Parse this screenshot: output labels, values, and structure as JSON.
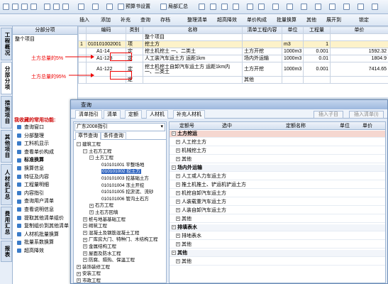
{
  "toolbar1": {
    "preview": "预算书设置",
    "local_summary": "局部汇总"
  },
  "toolbar2": {
    "insert": "插入",
    "add": "添加",
    "supplement": "补充",
    "query": "查询",
    "store": "存档",
    "organize": "整理清单",
    "super_drop": "超高降效",
    "unit_composition": "单价构成",
    "batch_replace": "批量换算",
    "other": "其他",
    "expand_to": "展开到",
    "lock": "锁定"
  },
  "vtabs": [
    "工程概况",
    "分部分项",
    "措施项目",
    "其他项目",
    "人材机汇总",
    "费用汇总",
    "报表"
  ],
  "left_panel": {
    "header": "分部分项",
    "root": "整个项目",
    "common_title": "我收藏的常用功能:",
    "common_items": [
      "查询窗口",
      "分部整理",
      "工料机显示",
      "查看单价构成",
      "标准换算",
      "换算信息",
      "特征及内容",
      "工程量明细",
      "内容指引",
      "查询用户清单",
      "查看说明信息",
      "提取其他清单组价",
      "复制组价到其他清单",
      "人材机批量换算",
      "批量系数换算",
      "超高降效"
    ]
  },
  "main_grid": {
    "headers": [
      "",
      "编码",
      "类别",
      "名称",
      "清单工程内容",
      "单位",
      "工程量",
      "单价"
    ],
    "rows": [
      {
        "num": "",
        "code": "",
        "type": "",
        "name": "整个项目",
        "content": "",
        "unit": "",
        "qty": "",
        "price": ""
      },
      {
        "num": "1",
        "code": "010101002001",
        "type": "项",
        "name": "挖土方",
        "content": "",
        "unit": "m3",
        "qty": "1",
        "price": ""
      },
      {
        "num": "",
        "code": "A1-14",
        "type": "定",
        "name": "挖土机挖土 一、二类土",
        "content": "土方开挖",
        "unit": "1000m3",
        "qty": "0.001",
        "price": "1592.32"
      },
      {
        "num": "",
        "code": "A1-128",
        "type": "定",
        "name": "人工装汽车运土方 运距1km",
        "content": "场内外运输",
        "unit": "1000m3",
        "qty": "0.01",
        "price": "1804.9"
      },
      {
        "num": "",
        "code": "A1-122",
        "type": "定",
        "name": "挖土机挖土自卸汽车运土方 运距1km内 一、二类土",
        "content": "土方开挖",
        "unit": "1000m3",
        "qty": "0.001",
        "price": "7414.65"
      },
      {
        "num": "",
        "code": "",
        "type": "定",
        "name": "",
        "content": "其他",
        "unit": "",
        "qty": "",
        "price": ""
      }
    ]
  },
  "annotations": {
    "first": "土方总量的5%",
    "second": "土方总量的95%"
  },
  "dialog": {
    "title": "查询",
    "tabs": [
      "清单指引",
      "清单",
      "定额",
      "人材机",
      "补充人材机"
    ],
    "insert_child": "插入子目",
    "insert_list": "插入清单(I)",
    "combo_value": "广东2008指引",
    "subtabs": [
      "章节查询",
      "条件查询"
    ],
    "tree": [
      "建筑工程",
      "土石方工程",
      "土方工程",
      "010101001 平整场地",
      "010101002 挖土方",
      "010101003 挖基础土方",
      "010101004 冻土开挖",
      "010101005 挖淤泥、流砂",
      "010101006 管沟土石方",
      "石方工程",
      "土石方回填",
      "桩与地基基础工程",
      "砌筑工程",
      "混凝土及钢筋混凝土工程",
      "厂库房大门、特种门、木结构工程",
      "金属结构工程",
      "屋面及防水工程",
      "防腐、隔热、保温工程",
      "装饰装修工程",
      "安装工程",
      "市政工程"
    ],
    "result_headers": [
      "定额号",
      "选中",
      "定额名称",
      "单位",
      "单价"
    ],
    "result_rows": [
      {
        "label": "土方挖运",
        "group": true
      },
      {
        "label": "人工挖土方",
        "group": false
      },
      {
        "label": "机械挖土方",
        "group": false
      },
      {
        "label": "其他",
        "group": false
      },
      {
        "label": "场内外运输",
        "group": true
      },
      {
        "label": "人工或人力车运土方",
        "group": false
      },
      {
        "label": "推土机推土、铲运机铲运土方",
        "group": false
      },
      {
        "label": "机挖自卸汽车运土方",
        "group": false
      },
      {
        "label": "人装载重汽车运土方",
        "group": false
      },
      {
        "label": "人装自卸汽车运土方",
        "group": false
      },
      {
        "label": "其他",
        "group": false
      },
      {
        "label": "排填表水",
        "group": true
      },
      {
        "label": "排地表水",
        "group": false
      },
      {
        "label": "其他",
        "group": false
      },
      {
        "label": "其他",
        "group": true
      },
      {
        "label": "其他",
        "group": false
      }
    ]
  }
}
